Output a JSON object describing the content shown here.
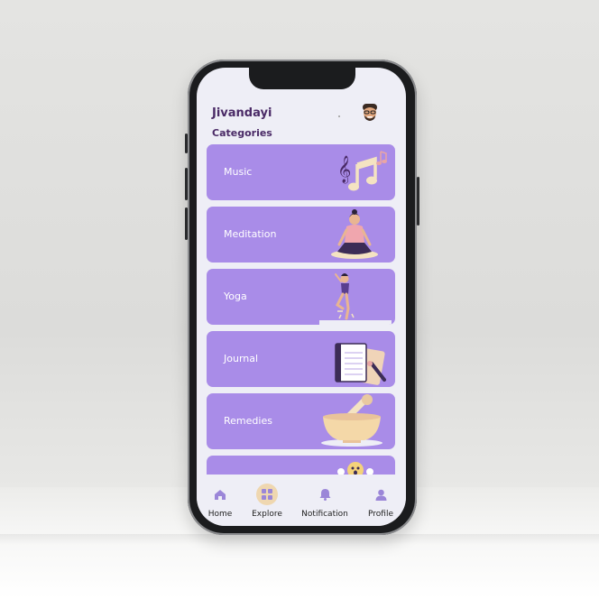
{
  "app": {
    "title": "Jivandayi"
  },
  "categories": {
    "heading": "Categories",
    "items": [
      {
        "label": "Music",
        "icon": "music-notes-icon"
      },
      {
        "label": "Meditation",
        "icon": "meditation-illustration"
      },
      {
        "label": "Yoga",
        "icon": "yoga-illustration"
      },
      {
        "label": "Journal",
        "icon": "journal-illustration"
      },
      {
        "label": "Remedies",
        "icon": "mortar-pestle-illustration"
      }
    ]
  },
  "tabbar": {
    "tabs": [
      {
        "label": "Home",
        "icon": "home-icon"
      },
      {
        "label": "Explore",
        "icon": "grid-icon",
        "active": true
      },
      {
        "label": "Notification",
        "icon": "bell-icon"
      },
      {
        "label": "Profile",
        "icon": "person-icon"
      }
    ]
  },
  "colors": {
    "card": "#a98ce8",
    "heading": "#4a2a66",
    "tab_icon": "#9b86d8",
    "active_tab_bg": "#efd7b0"
  }
}
